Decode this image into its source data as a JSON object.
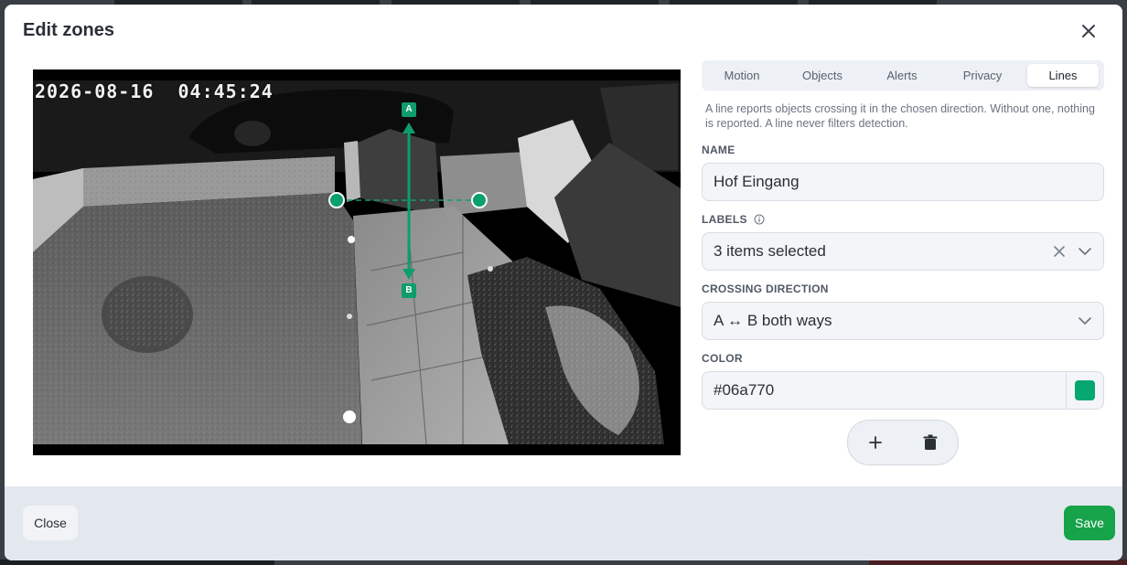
{
  "dialog": {
    "title": "Edit zones",
    "close_icon": "close-icon"
  },
  "camera": {
    "timestamp": "2026-08-16  04:45:24",
    "line": {
      "marker_a": "A",
      "marker_b": "B",
      "color": "#0f9d6b"
    }
  },
  "tabs": [
    {
      "label": "Motion",
      "active": false
    },
    {
      "label": "Objects",
      "active": false
    },
    {
      "label": "Alerts",
      "active": false
    },
    {
      "label": "Privacy",
      "active": false
    },
    {
      "label": "Lines",
      "active": true
    }
  ],
  "help_text": "A line reports objects crossing it in the chosen direction. Without one, nothing is reported. A line never filters detection.",
  "form": {
    "name_label": "NAME",
    "name_value": "Hof Eingang",
    "labels_label": "LABELS",
    "labels_value": "3 items selected",
    "direction_label": "CROSSING DIRECTION",
    "direction_value": "A ↔ B both ways",
    "color_label": "COLOR",
    "color_value": "#06a770"
  },
  "actions": {
    "add_icon": "plus-icon",
    "delete_icon": "trash-icon"
  },
  "footer": {
    "close_label": "Close",
    "save_label": "Save",
    "save_color": "#17a34a"
  }
}
